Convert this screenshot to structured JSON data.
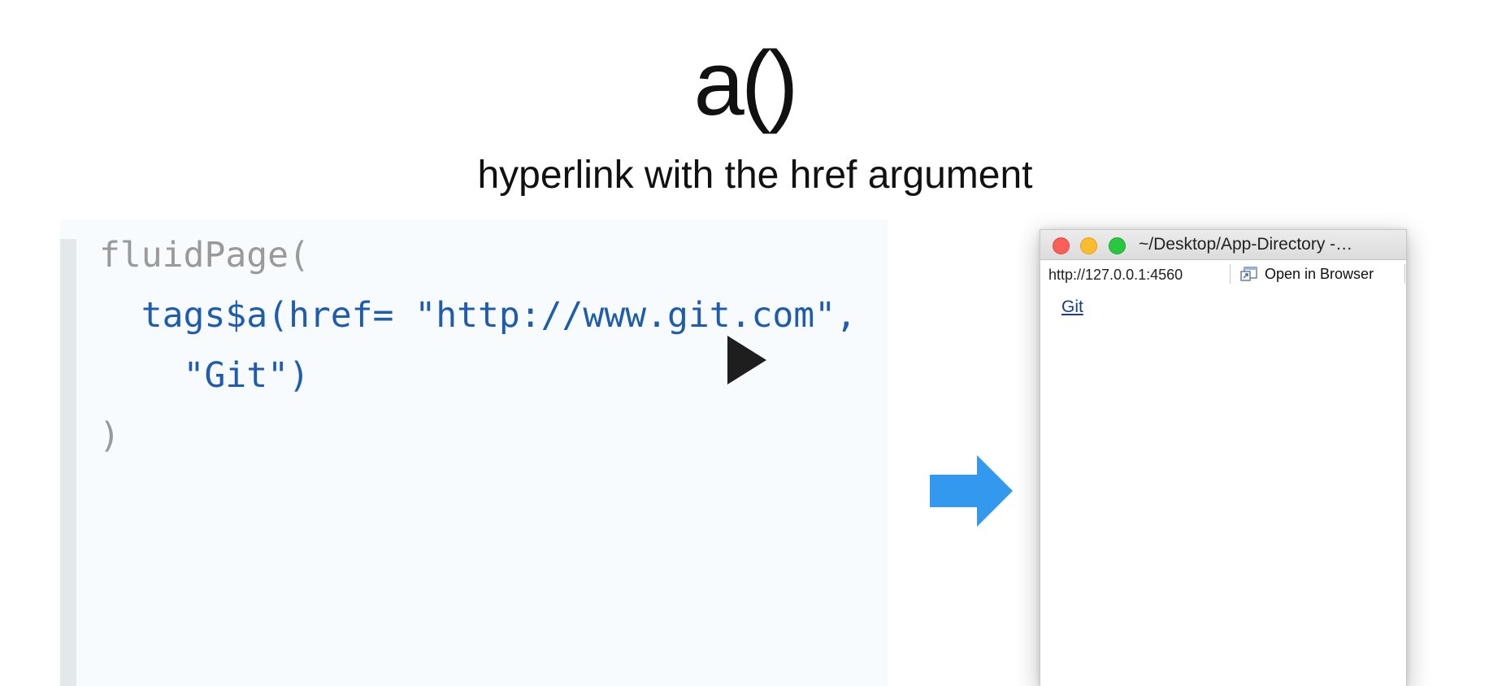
{
  "slide": {
    "title": "a()",
    "subtitle": "hyperlink with the href argument"
  },
  "code": {
    "lines": [
      "fluidPage(",
      "  tags$a(href= \"http://www.git.com\",",
      "    \"Git\")",
      ")"
    ],
    "colors": {
      "muted": "#9a9a9a",
      "accent": "#1f5cad"
    }
  },
  "video": {
    "play_icon": "play-icon"
  },
  "arrow": {
    "icon": "right-arrow-icon",
    "color": "#3399ee"
  },
  "app_window": {
    "title": "~/Desktop/App-Directory -…",
    "url": "http://127.0.0.1:4560",
    "open_in_browser_label": "Open in Browser",
    "link_text": "Git"
  }
}
